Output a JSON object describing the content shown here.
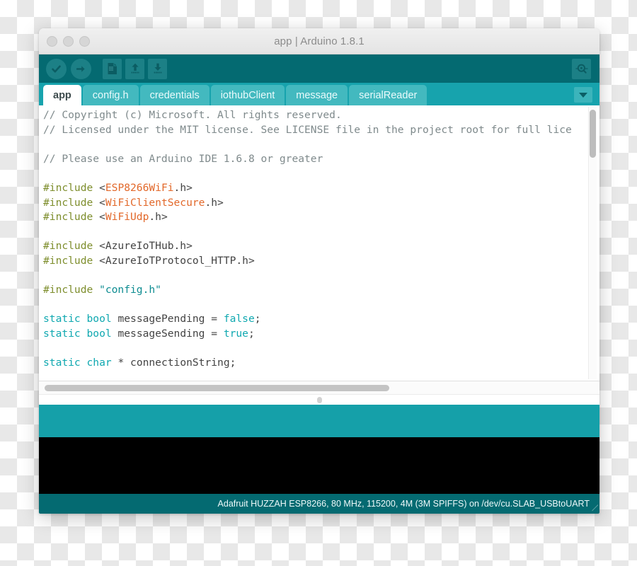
{
  "window": {
    "title": "app | Arduino 1.8.1",
    "traffic_lights": [
      "close",
      "minimize",
      "zoom"
    ]
  },
  "toolbar": {
    "buttons": [
      {
        "name": "verify-button",
        "icon": "checkmark-icon",
        "label": "Verify"
      },
      {
        "name": "upload-button",
        "icon": "arrow-right-icon",
        "label": "Upload"
      },
      {
        "name": "new-button",
        "icon": "new-document-icon",
        "label": "New"
      },
      {
        "name": "open-button",
        "icon": "arrow-up-icon",
        "label": "Open"
      },
      {
        "name": "save-button",
        "icon": "arrow-down-icon",
        "label": "Save"
      }
    ],
    "serial_monitor": {
      "name": "serial-monitor-button",
      "icon": "magnifier-icon",
      "label": "Serial Monitor"
    }
  },
  "tabs": {
    "items": [
      {
        "label": "app",
        "active": true
      },
      {
        "label": "config.h",
        "active": false
      },
      {
        "label": "credentials",
        "active": false
      },
      {
        "label": "iothubClient",
        "active": false
      },
      {
        "label": "message",
        "active": false
      },
      {
        "label": "serialReader",
        "active": false
      }
    ],
    "menu_icon": "chevron-down-icon"
  },
  "editor": {
    "lines": [
      [
        {
          "t": "// Copyright (c) Microsoft. All rights reserved.",
          "c": "cmt"
        }
      ],
      [
        {
          "t": "// Licensed under the MIT license. See LICENSE file in the project root for full lice",
          "c": "cmt"
        }
      ],
      [],
      [
        {
          "t": "// Please use an Arduino IDE 1.6.8 or greater",
          "c": "cmt"
        }
      ],
      [],
      [
        {
          "t": "#include ",
          "c": "pre"
        },
        {
          "t": "<",
          "c": "punc"
        },
        {
          "t": "ESP8266WiFi",
          "c": "lib"
        },
        {
          "t": ".h>",
          "c": "punc"
        }
      ],
      [
        {
          "t": "#include ",
          "c": "pre"
        },
        {
          "t": "<",
          "c": "punc"
        },
        {
          "t": "WiFiClientSecure",
          "c": "lib"
        },
        {
          "t": ".h>",
          "c": "punc"
        }
      ],
      [
        {
          "t": "#include ",
          "c": "pre"
        },
        {
          "t": "<",
          "c": "punc"
        },
        {
          "t": "WiFiUdp",
          "c": "lib"
        },
        {
          "t": ".h>",
          "c": "punc"
        }
      ],
      [],
      [
        {
          "t": "#include ",
          "c": "pre"
        },
        {
          "t": "<AzureIoTHub.h>",
          "c": "punc"
        }
      ],
      [
        {
          "t": "#include ",
          "c": "pre"
        },
        {
          "t": "<AzureIoTProtocol_HTTP.h>",
          "c": "punc"
        }
      ],
      [],
      [
        {
          "t": "#include ",
          "c": "pre"
        },
        {
          "t": "\"config.h\"",
          "c": "str"
        }
      ],
      [],
      [
        {
          "t": "static",
          "c": "kw"
        },
        {
          "t": " ",
          "c": "punc"
        },
        {
          "t": "bool",
          "c": "kw"
        },
        {
          "t": " messagePending = ",
          "c": "punc"
        },
        {
          "t": "false",
          "c": "lit"
        },
        {
          "t": ";",
          "c": "punc"
        }
      ],
      [
        {
          "t": "static",
          "c": "kw"
        },
        {
          "t": " ",
          "c": "punc"
        },
        {
          "t": "bool",
          "c": "kw"
        },
        {
          "t": " messageSending = ",
          "c": "punc"
        },
        {
          "t": "true",
          "c": "lit"
        },
        {
          "t": ";",
          "c": "punc"
        }
      ],
      [],
      [
        {
          "t": "static",
          "c": "kw"
        },
        {
          "t": " ",
          "c": "punc"
        },
        {
          "t": "char",
          "c": "kw"
        },
        {
          "t": " * connectionString;",
          "c": "punc"
        }
      ]
    ]
  },
  "status": {
    "text": "Adafruit HUZZAH ESP8266, 80 MHz, 115200, 4M (3M SPIFFS) on /dev/cu.SLAB_USBtoUART"
  },
  "colors": {
    "toolbar": "#046a71",
    "tabbar": "#17a3ad",
    "message_bar": "#15a0a9",
    "console": "#000000",
    "comment": "#7f8a8c",
    "preprocessor": "#7e8e2d",
    "library": "#e2682a",
    "keyword": "#0fa8b0",
    "string": "#0d8c91"
  }
}
